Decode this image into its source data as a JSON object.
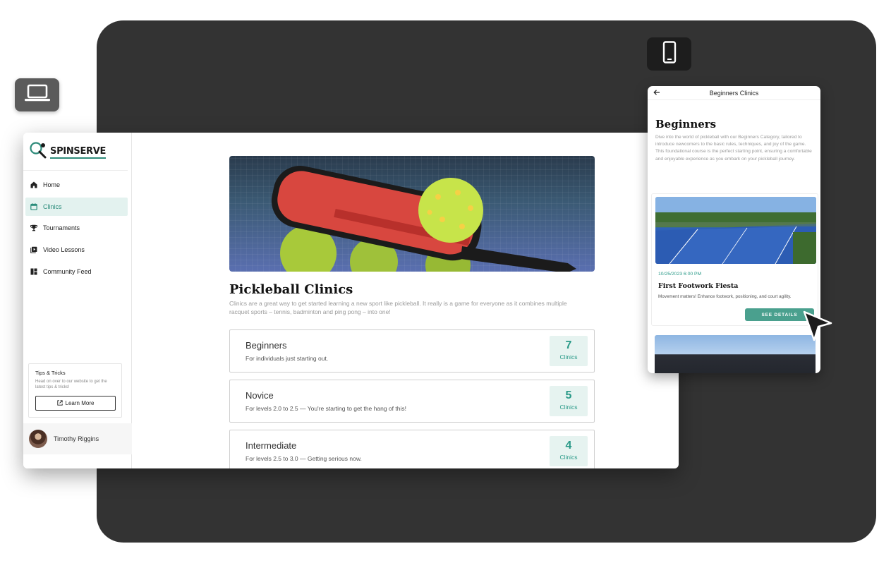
{
  "badges": {
    "laptop_icon": "laptop-icon",
    "phone_icon": "smartphone-icon"
  },
  "desktop": {
    "brand": "SPINSERVE",
    "nav": [
      {
        "label": "Home",
        "icon": "home-icon"
      },
      {
        "label": "Clinics",
        "icon": "calendar-icon",
        "active": true
      },
      {
        "label": "Tournaments",
        "icon": "trophy-icon"
      },
      {
        "label": "Video Lessons",
        "icon": "video-library-icon"
      },
      {
        "label": "Community Feed",
        "icon": "dashboard-icon"
      }
    ],
    "tips": {
      "title": "Tips & Tricks",
      "text": "Head on over to our website to get the latest tips & tricks!",
      "button": "Learn More"
    },
    "user": {
      "name": "Timothy Riggins"
    },
    "main": {
      "title": "Pickleball Clinics",
      "description": "Clinics are a great way to get started learning a new sport like pickleball. It really is a game for everyone as it combines multiple racquet sports – tennis, badminton and ping pong – into one!",
      "categories": [
        {
          "name": "Beginners",
          "subtitle": "For individuals just starting out.",
          "count": "7",
          "count_label": "Clinics"
        },
        {
          "name": "Novice",
          "subtitle": "For levels 2.0 to 2.5 — You're starting to get the hang of this!",
          "count": "5",
          "count_label": "Clinics"
        },
        {
          "name": "Intermediate",
          "subtitle": "For levels 2.5 to 3.0 — Getting serious now.",
          "count": "4",
          "count_label": "Clinics"
        }
      ]
    }
  },
  "mobile": {
    "header_title": "Beginners Clinics",
    "back_icon": "arrow-left-icon",
    "heading": "Beginners",
    "description": "Dive into the world of pickleball with our Beginners Category, tailored to introduce newcomers to the basic rules, techniques, and joy of the game. This foundational course is the perfect starting point, ensuring a comfortable and enjoyable experience as you embark on your pickleball journey.",
    "event": {
      "date": "10/25/2023 6:00 PM",
      "title": "First Footwork Fiesta",
      "description": "Movement matters! Enhance footwork, positioning, and court agility.",
      "button": "SEE DETAILS"
    }
  },
  "colors": {
    "accent": "#2a9a88",
    "panel": "#333333",
    "button": "#4aa08e"
  }
}
